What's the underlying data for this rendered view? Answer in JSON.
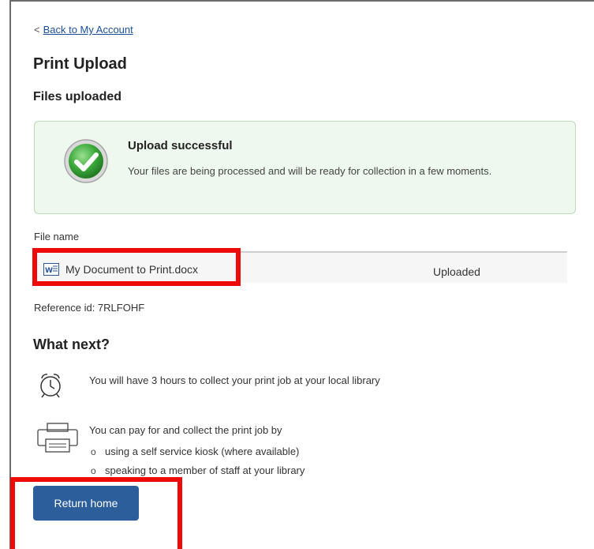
{
  "nav": {
    "back_prefix": "<",
    "back_link": "Back to My Account"
  },
  "page": {
    "title": "Print Upload",
    "subtitle": "Files uploaded"
  },
  "success": {
    "title": "Upload successful",
    "message": "Your files are being processed and will be ready for collection in a few moments.",
    "icon": "check-circle-icon",
    "color": "#3aa83a"
  },
  "files": {
    "column_label": "File name",
    "rows": [
      {
        "name": "My Document to Print.docx",
        "status": "Uploaded",
        "icon": "word-document-icon"
      }
    ],
    "reference": "Reference id: 7RLFOHF"
  },
  "next": {
    "heading": "What next?",
    "collect_note": "You will have 3 hours to collect your print job at your local library",
    "pay_note": "You can pay for and collect the print job by",
    "options": [
      "using a self service kiosk (where available)",
      "speaking to a member of staff at your library"
    ]
  },
  "actions": {
    "return_home": "Return home"
  },
  "colors": {
    "link": "#1a4f9c",
    "button": "#2b5e9b",
    "highlight": "#ef0a0a",
    "success_bg": "#eef8ee"
  }
}
